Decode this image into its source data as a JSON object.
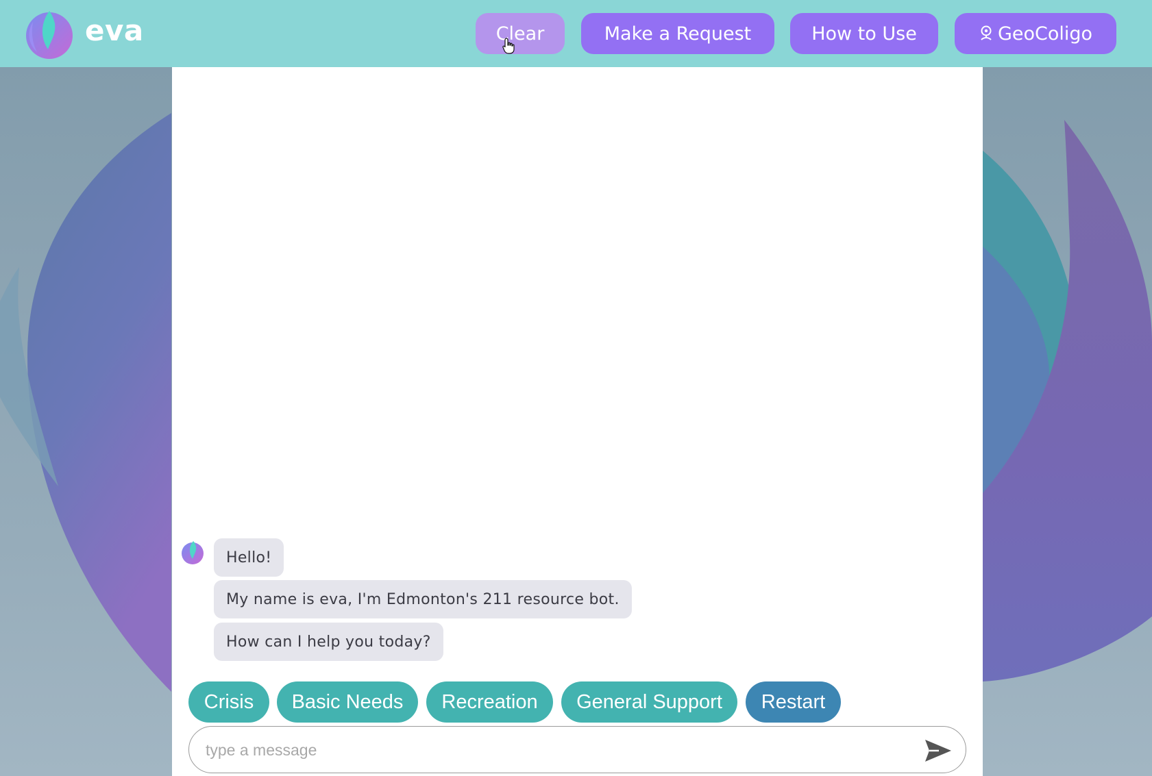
{
  "app": {
    "brand": "eva",
    "logo_icon": "eva-flame-logo-icon"
  },
  "header": {
    "buttons": [
      {
        "label": "Clear",
        "state": "hover"
      },
      {
        "label": "Make a Request"
      },
      {
        "label": "How to Use"
      },
      {
        "label": "GeoColigo",
        "icon": "location-pin-icon"
      }
    ]
  },
  "chat": {
    "avatar_icon": "eva-flame-avatar-icon",
    "messages": [
      {
        "sender": "bot",
        "text": "Hello!"
      },
      {
        "sender": "bot",
        "text": "My name is eva, I'm Edmonton's 211 resource bot."
      },
      {
        "sender": "bot",
        "text": "How can I help you today?"
      }
    ],
    "quick_replies": [
      {
        "label": "Crisis"
      },
      {
        "label": "Basic Needs"
      },
      {
        "label": "Recreation"
      },
      {
        "label": "General Support"
      },
      {
        "label": "Restart"
      }
    ]
  },
  "composer": {
    "value": "",
    "placeholder": "type a message",
    "send_icon": "send-arrow-icon"
  },
  "colors": {
    "header_bg": "#8ad6d6",
    "nav_button": "#9370f3",
    "nav_button_hover": "#b495ec",
    "chip": "#43b3b0",
    "chip_restart": "#3d86b3",
    "bubble": "#e5e5ec"
  }
}
